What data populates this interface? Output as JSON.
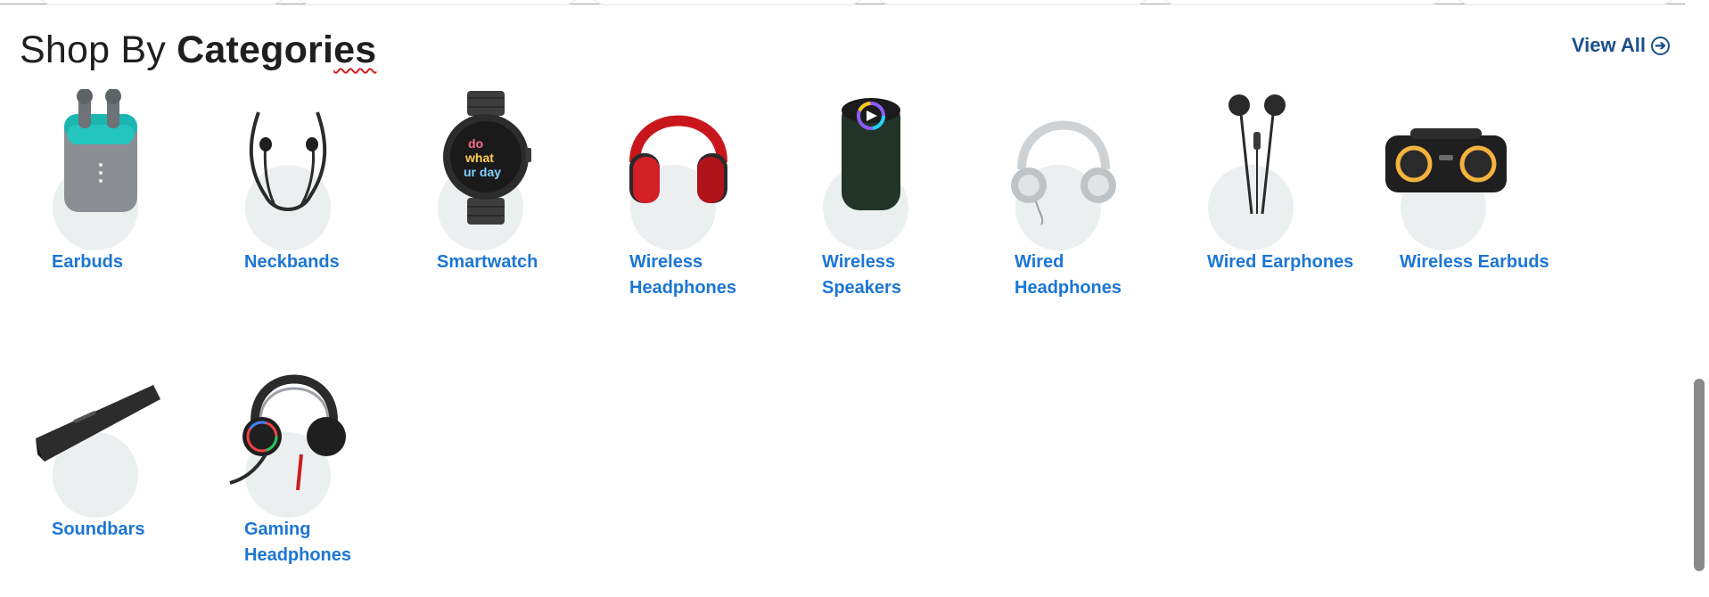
{
  "section": {
    "title_regular": "Shop By ",
    "title_bold": "Categori",
    "title_bold_squiggle": "es",
    "view_all_label": "View All",
    "view_all_icon": "arrow-right-circle-icon"
  },
  "categories": [
    {
      "label": "Earbuds",
      "icon": "earbuds-icon"
    },
    {
      "label": "Neckbands",
      "icon": "neckband-icon"
    },
    {
      "label": "Smartwatch",
      "icon": "smartwatch-icon"
    },
    {
      "label": "Wireless Headphones",
      "icon": "wireless-headphones-icon"
    },
    {
      "label": "Wireless Speakers",
      "icon": "wireless-speaker-icon"
    },
    {
      "label": "Wired Headphones",
      "icon": "wired-headphones-icon"
    },
    {
      "label": "Wired Earphones",
      "icon": "wired-earphones-icon"
    },
    {
      "label": "Wireless Earbuds",
      "icon": "party-speaker-icon"
    },
    {
      "label": "Soundbars",
      "icon": "soundbar-icon"
    },
    {
      "label": "Gaming Headphones",
      "icon": "gaming-headset-icon"
    }
  ],
  "colors": {
    "label": "#1b76d4",
    "view_all": "#1b4f8a",
    "circle_bg": "#eceff0",
    "title": "#1f1f1f",
    "spellcheck_squiggle": "#d11d1d"
  }
}
